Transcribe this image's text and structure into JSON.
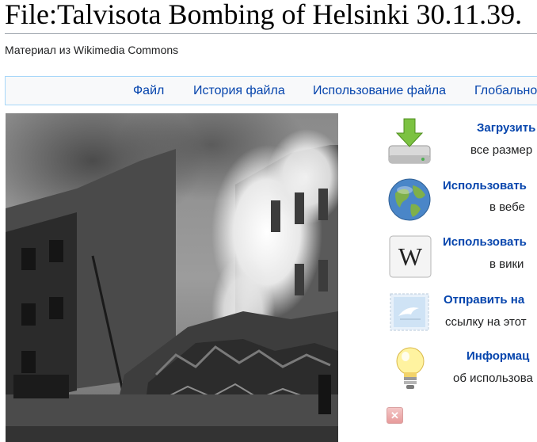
{
  "page": {
    "title": "File:Talvisota Bombing of Helsinki 30.11.39.",
    "subtitle": "Материал из Wikimedia Commons"
  },
  "tabs": [
    {
      "label": "Файл"
    },
    {
      "label": "История файла"
    },
    {
      "label": "Использование файла"
    },
    {
      "label": "Глобально"
    }
  ],
  "actions": [
    {
      "title": "Загрузить",
      "desc": "все размер",
      "icon": "download-drive-icon"
    },
    {
      "title": "Использовать",
      "desc": "в вебе",
      "icon": "globe-icon"
    },
    {
      "title": "Использовать",
      "desc": "в вики",
      "icon": "wikipedia-w-icon"
    },
    {
      "title": "Отправить на",
      "desc": "ссылку на этот",
      "icon": "email-bird-icon"
    },
    {
      "title": "Информац",
      "desc": "об использова",
      "icon": "lightbulb-icon"
    }
  ],
  "colors": {
    "link": "#0645ad",
    "tab_border": "#a7d7f9",
    "close_button": "#e79b9b"
  }
}
